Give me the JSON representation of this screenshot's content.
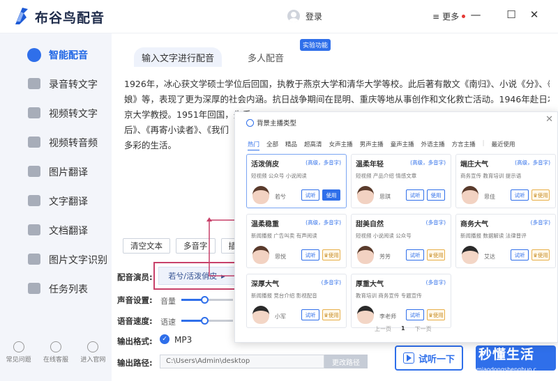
{
  "app": {
    "name": "布谷鸟配音",
    "login": "登录",
    "more": "更多"
  },
  "sidebar": {
    "items": [
      {
        "label": "智能配音",
        "active": true
      },
      {
        "label": "录音转文字"
      },
      {
        "label": "视频转文字"
      },
      {
        "label": "视频转音频"
      },
      {
        "label": "图片翻译"
      },
      {
        "label": "文字翻译"
      },
      {
        "label": "文档翻译"
      },
      {
        "label": "图片文字识别"
      },
      {
        "label": "任务列表"
      }
    ],
    "bottom": [
      {
        "label": "常见问题",
        "icon": "question-icon"
      },
      {
        "label": "在线客服",
        "icon": "headset-icon"
      },
      {
        "label": "进入官网",
        "icon": "bird-icon"
      }
    ]
  },
  "tabs": {
    "input_text": "输入文字进行配音",
    "multi": "多人配音",
    "badge": "实验功能"
  },
  "content": {
    "lines": [
      "1926年，冰心获文学硕士学位后回国，执教于燕京大学和清华大学等校。此后著有散文《南归》、小说《分》、《冬儿姑",
      "娘》等，表现了更为深厚的社会内涵。抗日战争期间在昆明、重庆等地从事创作和文化救亡活动。1946年赴日本，曾任东",
      "京大学教授。1951年回国，先后",
      "后》、《再寄小读者》、《我们",
      "多彩的生活。"
    ]
  },
  "buttons": {
    "clear": "清空文本",
    "polyphone": "多音字",
    "insert": "插入"
  },
  "form": {
    "actor_label": "配音演员:",
    "actor_value": "若兮/活泼俏皮",
    "voice_label": "声音设置:",
    "volume_label": "音量",
    "speed_label": "语音速度:",
    "speed_sub": "语速",
    "format_label": "输出格式:",
    "format_value": "MP3",
    "path_label": "输出路径:",
    "path_value": "C:\\Users\\Admin\\desktop",
    "path_button": "更改路径",
    "volume_level": 0.45,
    "speed_level": 0.45
  },
  "actions": {
    "try": "试听一下"
  },
  "watermark": {
    "main": "秒懂生活",
    "sub": "miaodongshenghuo.c"
  },
  "dialog": {
    "title": "背景主播类型",
    "categories": [
      "热门",
      "全部",
      "精品",
      "超高清",
      "女声主播",
      "男声主播",
      "童声主播",
      "外语主播",
      "方言主播",
      "|",
      "最近使用"
    ],
    "cards": [
      {
        "name": "活泼俏皮",
        "tag": "(高级，多音字)",
        "scenes": "短视频    公众号    小说阅读",
        "speaker": "若兮",
        "try": "试听",
        "use": "使用",
        "selected": true,
        "gender": "f",
        "style": "primary"
      },
      {
        "name": "温柔年轻",
        "tag": "(高级，多音字)",
        "scenes": "短视频    产品介绍    情感文章",
        "speaker": "思琪",
        "try": "试听",
        "use": "使用",
        "gender": "f",
        "style": "normal"
      },
      {
        "name": "端庄大气",
        "tag": "(高级，多音字)",
        "scenes": "商务宣传    教育培训    提示语",
        "speaker": "思佳",
        "try": "试听",
        "use": "使用",
        "gender": "f",
        "style": "vip"
      },
      {
        "name": "温柔稳重",
        "tag": "(高级，多音字)",
        "scenes": "新闻播报    广告叫卖    有声阅读",
        "speaker": "思悦",
        "try": "试听",
        "use": "使用",
        "gender": "f",
        "style": "vip"
      },
      {
        "name": "甜美自然",
        "tag": "(多音字)",
        "scenes": "短视频    小说阅读    公众号",
        "speaker": "芳芳",
        "try": "试听",
        "use": "使用",
        "gender": "f",
        "style": "vip"
      },
      {
        "name": "商务大气",
        "tag": "(多音字)",
        "scenes": "新闻播报    数据解读    法律普评",
        "speaker": "艾达",
        "try": "试听",
        "use": "使用",
        "gender": "m",
        "style": "vip"
      },
      {
        "name": "深厚大气",
        "tag": "(多音字)",
        "scenes": "新闻播报    竞台介绍    影视配音",
        "speaker": "小军",
        "try": "试听",
        "use": "使用",
        "gender": "m",
        "style": "vip"
      },
      {
        "name": "厚重大气",
        "tag": "(多音字)",
        "scenes": "教育培训    商务宣传    专题宣传",
        "speaker": "李老师",
        "try": "试听",
        "use": "使用",
        "gender": "m",
        "style": "vip"
      }
    ],
    "pager": {
      "prev": "上一页",
      "page": "1",
      "next": "下一页"
    }
  }
}
